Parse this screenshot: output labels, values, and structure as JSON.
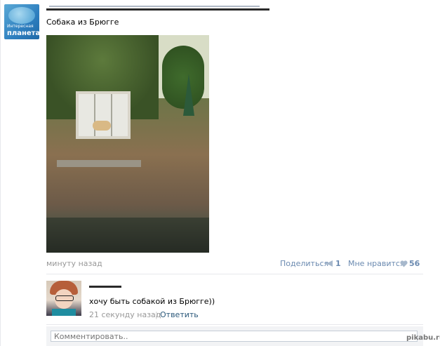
{
  "post": {
    "text": "Собака из Брюгге",
    "time": "минуту назад"
  },
  "community": {
    "avatar_line1": "Интересная",
    "avatar_line2": "планета"
  },
  "actions": {
    "share_label": "Поделиться",
    "share_count": "1",
    "like_label": "Мне нравится",
    "like_count": "56"
  },
  "comment": {
    "text": "хочу быть собакой из Брюгге))",
    "time": "21 секунду назад",
    "divider": "|",
    "reply_label": "Ответить"
  },
  "comment_box": {
    "placeholder": "Комментировать.."
  },
  "watermark": "pikabu.ru",
  "colors": {
    "link": "#2b587a",
    "action": "#6b8ab0",
    "muted": "#999999"
  },
  "icons": [
    "megaphone-icon",
    "heart-icon"
  ]
}
